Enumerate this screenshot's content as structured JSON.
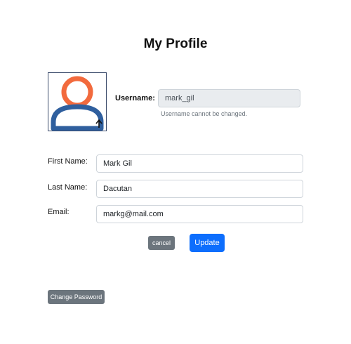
{
  "page": {
    "title": "My Profile"
  },
  "avatar": {
    "icon": "user-avatar-icon",
    "head_color": "#f26a3d",
    "body_color": "#2f5f9e"
  },
  "username": {
    "label": "Username:",
    "value": "mark_gil",
    "help": "Username cannot be changed."
  },
  "form": {
    "first_name": {
      "label": "First Name:",
      "value": "Mark Gil"
    },
    "last_name": {
      "label": "Last Name:",
      "value": "Dacutan"
    },
    "email": {
      "label": "Email:",
      "value": "markg@mail.com"
    }
  },
  "actions": {
    "cancel_label": "cancel",
    "update_label": "Update"
  },
  "change_password_label": "Change Password",
  "colors": {
    "primary": "#0d6efd",
    "secondary": "#6c757d"
  }
}
